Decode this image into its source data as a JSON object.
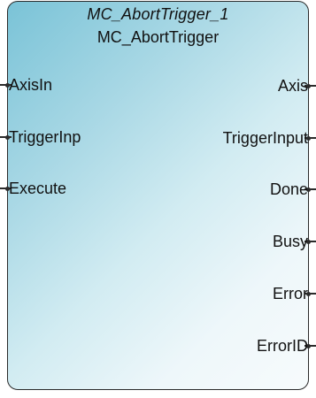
{
  "block": {
    "instance_name": "MC_AbortTrigger_1",
    "type_name": "MC_AbortTrigger",
    "inputs": [
      {
        "label": "AxisIn"
      },
      {
        "label": "TriggerInp"
      },
      {
        "label": "Execute"
      }
    ],
    "outputs": [
      {
        "label": "Axis"
      },
      {
        "label": "TriggerInput"
      },
      {
        "label": "Done"
      },
      {
        "label": "Busy"
      },
      {
        "label": "Error"
      },
      {
        "label": "ErrorID"
      }
    ],
    "colors": {
      "border": "#2b2b2b",
      "gradient_start": "#7ac3d7",
      "gradient_end": "#f7fbfc"
    }
  }
}
